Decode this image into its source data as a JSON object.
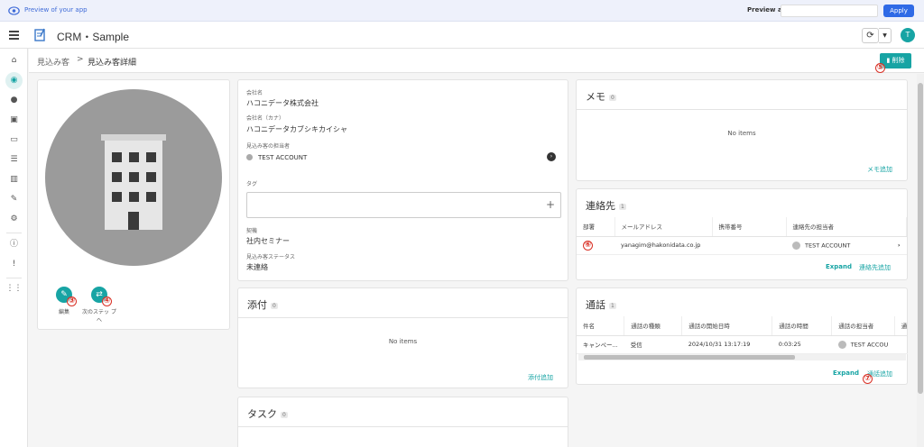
{
  "preview": {
    "label": "Preview of your app",
    "preview_as": "Preview as:",
    "apply": "Apply"
  },
  "header": {
    "app_title": "CRM・Sample",
    "user_initial": "T"
  },
  "breadcrumb": {
    "parent": "見込み客",
    "separator": ">",
    "current": "見込み客詳細",
    "delete_label": "削除"
  },
  "markers": {
    "m3": "③",
    "m4": "④",
    "m5": "⑤",
    "m6": "⑥",
    "m7": "⑦"
  },
  "actions": {
    "edit": "編集",
    "next_step": "次のステッ プへ"
  },
  "info": {
    "company_label": "会社名",
    "company_value": "ハコニデータ株式会社",
    "kana_label": "会社名（カナ）",
    "kana_value": "ハコニデータカブシキカイシャ",
    "owner_label": "見込み客の担当者",
    "owner_value": "TEST ACCOUNT",
    "tag_label": "タグ",
    "source_label": "契機",
    "source_value": "社内セミナー",
    "status_label": "見込み客ステータス",
    "status_value": "未連絡"
  },
  "attachments": {
    "title": "添付",
    "count": "0",
    "empty": "No items",
    "add": "添付追加"
  },
  "tasks": {
    "title": "タスク",
    "count": "0"
  },
  "memo": {
    "title": "メモ",
    "count": "0",
    "empty": "No items",
    "add": "メモ追加"
  },
  "contacts": {
    "title": "連絡先",
    "count": "1",
    "columns": [
      "部署",
      "メールアドレス",
      "携帯番号",
      "連絡先の担当者"
    ],
    "rows": [
      {
        "dept": "",
        "email": "yanagim@hakonidata.co.jp",
        "mobile": "",
        "owner": "TEST ACCOUNT"
      }
    ],
    "expand": "Expand",
    "add": "連絡先追加"
  },
  "calls": {
    "title": "通話",
    "count": "1",
    "columns": [
      "件名",
      "通話の種類",
      "通話の開始日時",
      "通話の時間",
      "通話の担当者",
      "通"
    ],
    "rows": [
      {
        "subject": "キャンペー...",
        "type": "受信",
        "start": "2024/10/31 13:17:19",
        "duration": "0:03:25",
        "owner": "TEST ACCOU"
      }
    ],
    "expand": "Expand",
    "add": "通話追加"
  },
  "colors": {
    "accent": "#17a4a4",
    "primary": "#2f6ae6",
    "marker": "#d93025"
  }
}
